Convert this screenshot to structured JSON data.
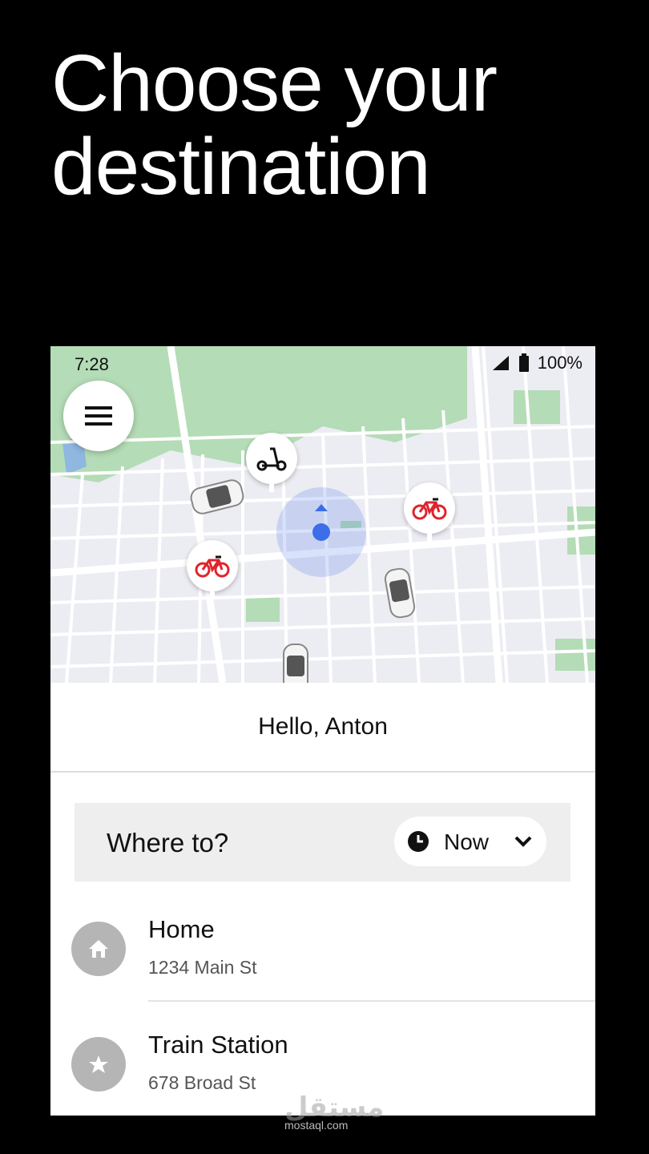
{
  "headline": {
    "line1": "Choose your",
    "line2": "destination"
  },
  "status_bar": {
    "time": "7:28",
    "battery": "100%"
  },
  "map": {
    "menu_icon": "hamburger-menu-icon",
    "location_color": "#3b6ee8",
    "vehicles": [
      "scooter-icon",
      "bike-icon",
      "bike-icon",
      "car-icon",
      "car-icon",
      "car-icon"
    ]
  },
  "greeting": "Hello, Anton",
  "search": {
    "label": "Where to?",
    "time_label": "Now"
  },
  "saved_places": [
    {
      "name": "Home",
      "address": "1234 Main St",
      "icon": "home-icon"
    },
    {
      "name": "Train Station",
      "address": "678 Broad St",
      "icon": "star-icon"
    }
  ],
  "watermark": {
    "arabic": "مستقل",
    "latin": "mostaql.com"
  },
  "colors": {
    "background": "#000000",
    "bike_red": "#e0242c",
    "map_bg": "#ececf3",
    "park_green": "#b4dcb6"
  }
}
